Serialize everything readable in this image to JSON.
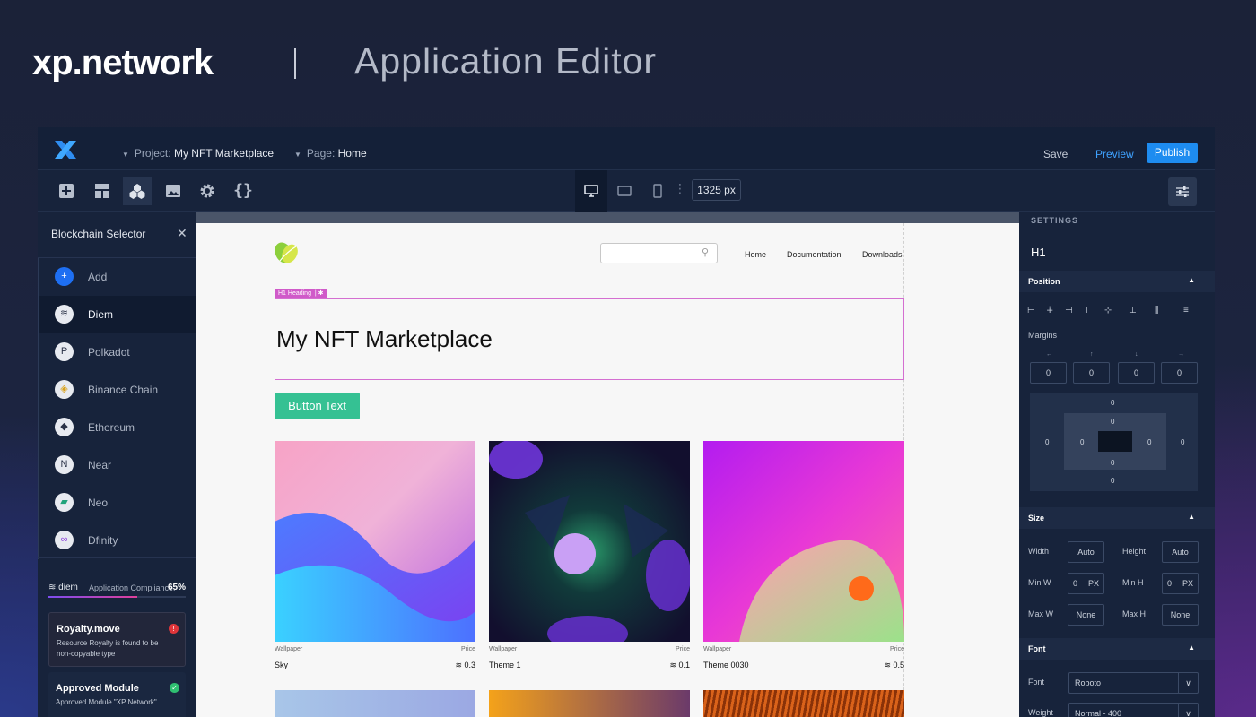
{
  "header": {
    "brand": "xp.network",
    "title": "Application Editor"
  },
  "topbar": {
    "project_label": "Project:",
    "project_value": "My NFT Marketplace",
    "page_label": "Page:",
    "page_value": "Home",
    "save": "Save",
    "preview": "Preview",
    "publish": "Publish"
  },
  "toolbar": {
    "tools": [
      "add-icon",
      "layout-icon",
      "blocks-icon",
      "image-icon",
      "gear-icon",
      "code-icon"
    ],
    "active_tool": "blocks-icon",
    "devices": [
      "desktop-icon",
      "tablet-icon",
      "mobile-icon"
    ],
    "active_device": "desktop-icon",
    "width": "1325 px"
  },
  "left_panel": {
    "title": "Blockchain Selector",
    "chains": [
      {
        "label": "Add",
        "icon": "+"
      },
      {
        "label": "Diem",
        "icon": "≋"
      },
      {
        "label": "Polkadot",
        "icon": "P"
      },
      {
        "label": "Binance Chain",
        "icon": "◈"
      },
      {
        "label": "Ethereum",
        "icon": "◆"
      },
      {
        "label": "Near",
        "icon": "N"
      },
      {
        "label": "Neo",
        "icon": "▰"
      },
      {
        "label": "Dfinity",
        "icon": "∞"
      }
    ],
    "selected": "Diem",
    "compliance": {
      "brand": "≋ diem",
      "label": "Application Compliance:",
      "value": "65%",
      "progress": 0.65
    },
    "cards": [
      {
        "title": "Royalty.move",
        "desc": "Resource Royalty is found to be non-copyable type",
        "status": "error",
        "status_icon": "!"
      },
      {
        "title": "Approved Module",
        "desc": "Approved Module \"XP Network\"",
        "status": "ok",
        "status_icon": "✓"
      }
    ]
  },
  "canvas": {
    "nav": [
      "Home",
      "Documentation",
      "Downloads"
    ],
    "h1_tag": "H1 Heading",
    "h1_gear": "✱",
    "heading": "My NFT Marketplace",
    "cta": "Button Text",
    "nfts": [
      {
        "category": "Wallpaper",
        "price_label": "Price",
        "name": "Sky",
        "price": "≋ 0.3"
      },
      {
        "category": "Wallpaper",
        "price_label": "Price",
        "name": "Theme 1",
        "price": "≋ 0.1"
      },
      {
        "category": "Wallpaper",
        "price_label": "Price",
        "name": "Theme 0030",
        "price": "≋ 0.5"
      }
    ]
  },
  "right_panel": {
    "header": "SETTINGS",
    "selected": "H1",
    "position": {
      "title": "Position",
      "margins_label": "Margins",
      "margins": [
        "0",
        "0",
        "0",
        "0"
      ],
      "box": {
        "outer_top": "0",
        "outer_bottom": "0",
        "outer_left": "0",
        "outer_right": "0",
        "inner_top": "0",
        "inner_bottom": "0",
        "inner_left": "0",
        "inner_right": "0"
      }
    },
    "size": {
      "title": "Size",
      "width_label": "Width",
      "width": "Auto",
      "height_label": "Height",
      "height": "Auto",
      "minw_label": "Min W",
      "minw": "0",
      "minw_unit": "PX",
      "minh_label": "Min H",
      "minh": "0",
      "minh_unit": "PX",
      "maxw_label": "Max W",
      "maxw": "None",
      "maxh_label": "Max H",
      "maxh": "None"
    },
    "font": {
      "title": "Font",
      "font_label": "Font",
      "font": "Roboto",
      "weight_label": "Weight",
      "weight": "Normal - 400"
    }
  },
  "colors": {
    "accent": "#1e8cf0",
    "cta": "#35c193",
    "selection": "#d46fd1"
  }
}
